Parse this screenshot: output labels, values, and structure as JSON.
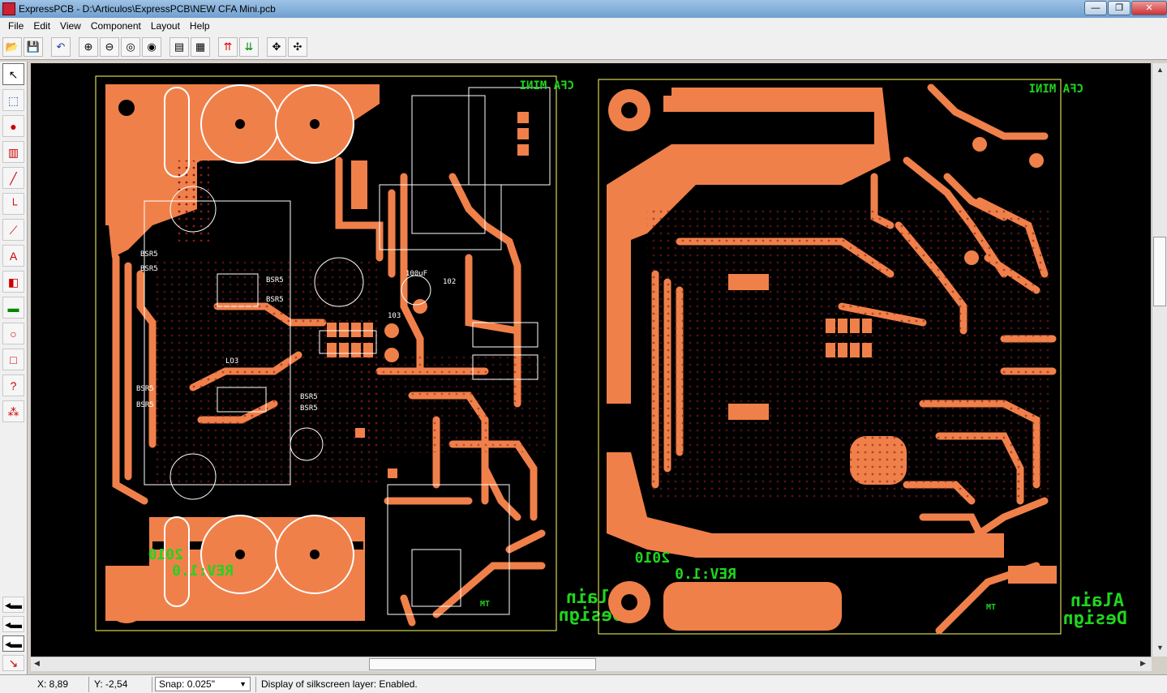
{
  "window": {
    "app_name": "ExpressPCB",
    "title": "ExpressPCB - D:\\Articulos\\ExpressPCB\\NEW CFA Mini.pcb",
    "min_label": "—",
    "max_label": "❐",
    "close_label": "✕"
  },
  "menu": [
    "File",
    "Edit",
    "View",
    "Component",
    "Layout",
    "Help"
  ],
  "toolbar": {
    "icons": [
      "open-icon",
      "save-icon",
      "undo-icon",
      "zoom-in-icon",
      "zoom-out-icon",
      "zoom-fit-icon",
      "zoom-page-icon",
      "component-properties-icon",
      "trace-properties-icon",
      "top-layer-icon",
      "bottom-layer-icon",
      "move-icon",
      "move-all-icon"
    ]
  },
  "left_tools": [
    "select-tool-icon",
    "zoom-area-tool-icon",
    "pad-tool-icon",
    "component-tool-icon",
    "trace-tool-icon",
    "dimension-tool-icon",
    "rat-trace-tool-icon",
    "text-tool-icon",
    "filled-plane-tool-icon",
    "ground-plane-tool-icon",
    "circle-tool-icon",
    "board-outline-tool-icon",
    "query-tool-icon",
    "netlist-tool-icon"
  ],
  "layer_tools": [
    "top-copper-layer-icon",
    "bottom-copper-layer-icon",
    "silkscreen-layer-icon",
    "show-all-layers-icon"
  ],
  "board_left": {
    "title": "CFA MINI",
    "year": "2010",
    "rev": "REV:1.0",
    "designer": "Alain",
    "design_word": "Design",
    "tm": "TM",
    "labels": [
      "BSR5",
      "BSR5",
      "BSR5",
      "BSR5",
      "BSR5",
      "BSR5",
      "BSR5",
      "BSR5",
      "100uF",
      "102",
      "103",
      "LO3"
    ]
  },
  "board_right": {
    "title": "CFA MINI",
    "year": "2010",
    "rev": "REV:1.0",
    "designer": "Alain",
    "design_word": "Design",
    "tm": "TM"
  },
  "colors": {
    "copper": "#f0804a",
    "background": "#000000",
    "silkscreen": "#ffffff",
    "board_outline": "#ffff66",
    "text_green": "#1fd51f",
    "via_dark": "#8b1a1a"
  },
  "status": {
    "x": "X: 8,89",
    "y": "Y: -2,54",
    "snap_label": "Snap:",
    "snap_value": "0.025\"",
    "message": "Display of silkscreen layer:  Enabled."
  }
}
